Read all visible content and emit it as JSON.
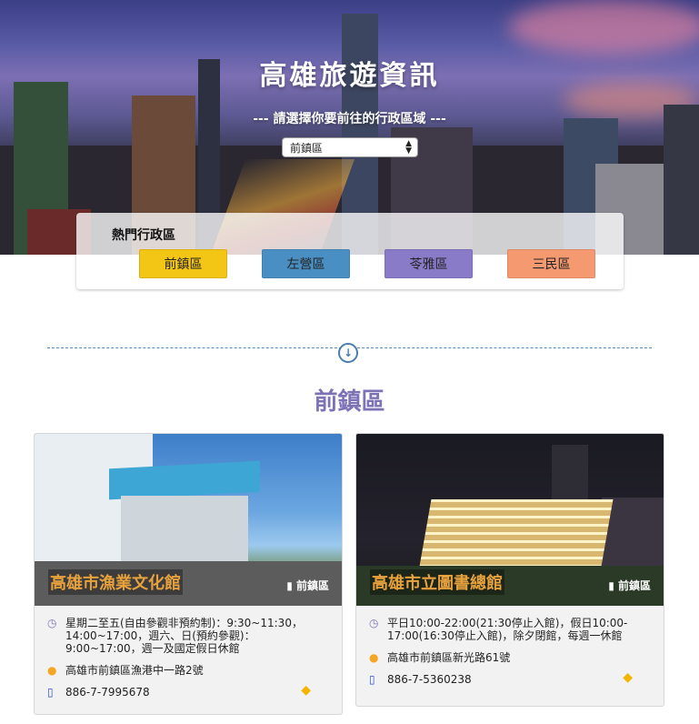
{
  "hero": {
    "title": "高雄旅遊資訊",
    "subtitle": "--- 請選擇你要前往的行政區域 ---",
    "select_value": "前鎮區"
  },
  "hot": {
    "title": "熱門行政區",
    "buttons": [
      {
        "label": "前鎮區",
        "color": "#f3c515"
      },
      {
        "label": "左營區",
        "color": "#4a8fc3"
      },
      {
        "label": "苓雅區",
        "color": "#8a7bc9"
      },
      {
        "label": "三民區",
        "color": "#f59a70"
      }
    ]
  },
  "section": {
    "title": "前鎮區"
  },
  "cards": [
    {
      "name": "高雄市漁業文化館",
      "district": "前鎮區",
      "hours": "星期二至五(自由參觀非預約制)：9:30~11:30，14:00~17:00，週六、日(預約參觀)：9:00~17:00，週一及國定假日休館",
      "address": "高雄市前鎮區漁港中一路2號",
      "phone": "886-7-7995678"
    },
    {
      "name": "高雄市立圖書總館",
      "district": "前鎮區",
      "hours": "平日10:00-22:00(21:30停止入館)，假日10:00-17:00(16:30停止入館)，除夕閉館，每週一休館",
      "address": "高雄市前鎮區新光路61號",
      "phone": "886-7-5360238"
    }
  ],
  "icons": {
    "clock": "clock-icon",
    "pin": "map-pin-icon",
    "phone": "phone-icon",
    "tag": "tag-icon",
    "bookmark": "bookmark-icon",
    "arrow": "arrow-down-circle-icon"
  },
  "colors": {
    "accent_purple": "#7d72b6",
    "divider_blue": "#4a7dae",
    "tag_gold": "#f5b400",
    "icon_orange": "#f5a623",
    "phone_blue": "#2a4fd6"
  }
}
